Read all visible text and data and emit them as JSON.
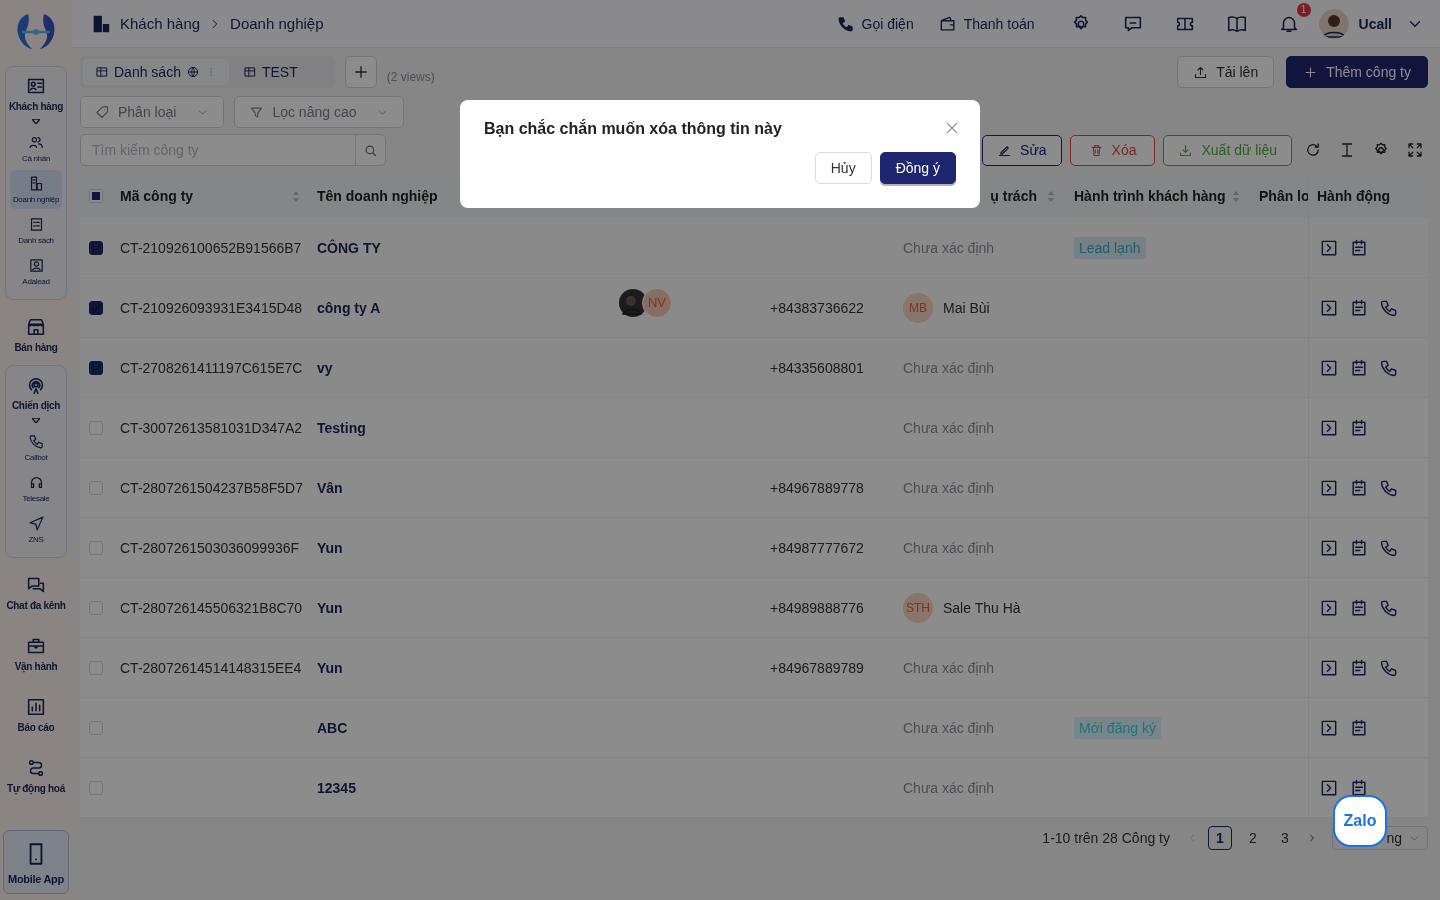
{
  "breadcrumb": {
    "items": [
      "Khách hàng",
      "Doanh nghiệp"
    ]
  },
  "topbar": {
    "links": [
      "Gọi điện",
      "Thanh toán"
    ],
    "notification_count": "1",
    "user": "Ucall"
  },
  "sidebar": {
    "items": [
      {
        "label": "Khách hàng",
        "selected": false,
        "expanded": true,
        "children": [
          {
            "label": "Cá nhân",
            "selected": false
          },
          {
            "label": "Doanh nghiệp",
            "selected": true
          },
          {
            "label": "Danh sách",
            "selected": false
          },
          {
            "label": "Adalead",
            "selected": false
          }
        ]
      },
      {
        "label": "Bán hàng",
        "selected": false
      },
      {
        "label": "Chiến dịch",
        "selected": false,
        "expanded": true,
        "children": [
          {
            "label": "Callbot",
            "selected": false
          },
          {
            "label": "Telesale",
            "selected": false
          },
          {
            "label": "ZNS",
            "selected": false
          }
        ]
      },
      {
        "label": "Chat đa kênh",
        "selected": false
      },
      {
        "label": "Vận hành",
        "selected": false
      },
      {
        "label": "Báo cáo",
        "selected": false
      },
      {
        "label": "Tự động hoá",
        "selected": false
      }
    ],
    "mobile_app": "Mobile App"
  },
  "views": {
    "tabs": [
      {
        "label": "Danh sách",
        "selected": true
      },
      {
        "label": "TEST",
        "selected": false
      }
    ],
    "count": "(2 views)"
  },
  "header_buttons": [
    "Tải lên",
    "Thêm công ty"
  ],
  "filters": [
    "Phân loại",
    "Lọc nâng cao"
  ],
  "search": {
    "placeholder": "Tìm kiếm công ty"
  },
  "bulk_buttons": [
    {
      "label": "Sửa",
      "kind": "edit"
    },
    {
      "label": "Xóa",
      "kind": "delete"
    },
    {
      "label": "Xuất dữ liệu",
      "kind": "export"
    }
  ],
  "table": {
    "select_all_partial": true,
    "columns": [
      {
        "label": "Mã công ty",
        "sortable": true
      },
      {
        "label": "Tên doanh nghiệp",
        "sortable": false
      },
      {
        "label": "ụ trách",
        "sortable": true
      },
      {
        "label": "Hành trình khách hàng",
        "sortable": true
      },
      {
        "label": "Phân lo",
        "sortable": false
      },
      {
        "label": "Hành động",
        "sortable": false
      }
    ],
    "rows": [
      {
        "checked": true,
        "code": "CT-210926100652B91566B7",
        "name": "CÔNG TY",
        "owner": {
          "kind": "unassigned",
          "text": "Chưa xác định"
        },
        "journey": {
          "label": "Lead lạnh",
          "color": "#215e70"
        },
        "callable": false
      },
      {
        "checked": true,
        "code": "CT-210926093931E3415D48",
        "name": "công ty A",
        "members": [
          {
            "kind": "photo"
          },
          {
            "kind": "initials",
            "text": "NV"
          }
        ],
        "phone": "+84383736622",
        "owner": {
          "kind": "person",
          "initials": "MB",
          "name": "Mai Bùi"
        },
        "callable": true
      },
      {
        "checked": true,
        "code": "CT-2708261411197C615E7C",
        "name": "vy",
        "phone": "+84335608801",
        "owner": {
          "kind": "unassigned",
          "text": "Chưa xác định"
        },
        "callable": true
      },
      {
        "checked": false,
        "code": "CT-30072613581031D347A2",
        "name": "Testing",
        "owner": {
          "kind": "unassigned",
          "text": "Chưa xác định"
        },
        "callable": false
      },
      {
        "checked": false,
        "code": "CT-2807261504237B58F5D7",
        "name": "Vân",
        "phone": "+84967889778",
        "owner": {
          "kind": "unassigned",
          "text": "Chưa xác định"
        },
        "callable": true
      },
      {
        "checked": false,
        "code": "CT-2807261503036099936F",
        "name": "Yun",
        "phone": "+84987777672",
        "owner": {
          "kind": "unassigned",
          "text": "Chưa xác định"
        },
        "callable": true
      },
      {
        "checked": false,
        "code": "CT-280726145506321B8C70",
        "name": "Yun",
        "phone": "+84989888776",
        "owner": {
          "kind": "person",
          "initials": "STH",
          "name": "Sale Thu Hà"
        },
        "callable": true
      },
      {
        "checked": false,
        "code": "CT-28072614514148315EE4",
        "name": "Yun",
        "phone": "+84967889789",
        "owner": {
          "kind": "unassigned",
          "text": "Chưa xác định"
        },
        "callable": true
      },
      {
        "checked": false,
        "name": "ABC",
        "owner": {
          "kind": "unassigned",
          "text": "Chưa xác định"
        },
        "journey": {
          "label": "Mới đăng ký",
          "color": "#23707e"
        },
        "callable": false
      },
      {
        "checked": false,
        "name": "12345",
        "owner": {
          "kind": "unassigned",
          "text": "Chưa xác định"
        },
        "callable": false
      }
    ]
  },
  "pagination": {
    "summary": "1-10 trên 28 Công ty",
    "pages": [
      {
        "label": "1",
        "selected": true
      },
      {
        "label": "2",
        "selected": false
      },
      {
        "label": "3",
        "selected": false
      }
    ],
    "page_size": "ng"
  },
  "dialog": {
    "title": "Bạn chắc chắn muốn xóa thông tin này",
    "buttons": [
      {
        "label": "Hủy",
        "kind": "secondary"
      },
      {
        "label": "Đồng ý",
        "kind": "primary"
      }
    ]
  },
  "chat_widget": "Zalo"
}
